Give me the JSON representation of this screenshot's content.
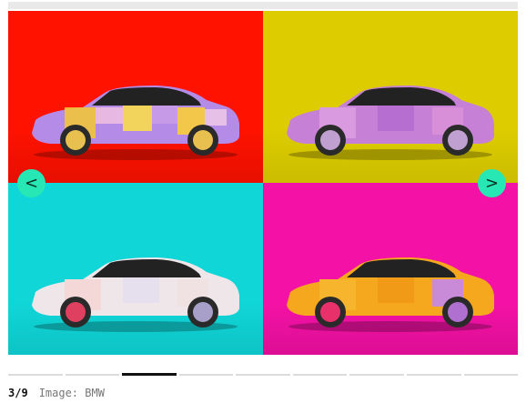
{
  "gallery": {
    "panels": [
      {
        "name": "red",
        "background": "#ff1200"
      },
      {
        "name": "yellow",
        "background": "#dccc00"
      },
      {
        "name": "cyan",
        "background": "#10d6d8"
      },
      {
        "name": "magenta",
        "background": "#f412a6"
      }
    ],
    "prev_label": "<",
    "next_label": ">",
    "accent_color": "#27e8b4"
  },
  "progress": {
    "total": 9,
    "current": 3
  },
  "caption": {
    "counter": "3/9",
    "credit": "Image: BMW"
  }
}
